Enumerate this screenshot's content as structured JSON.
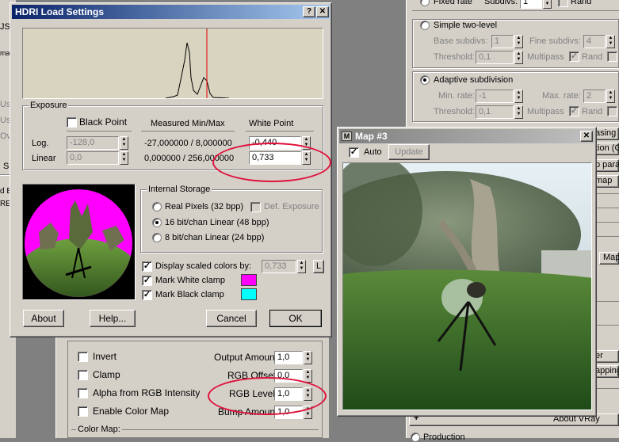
{
  "hdri_dialog": {
    "title": "HDRI Load Settings",
    "help_btn": "?",
    "close_btn": "✕",
    "exposure": {
      "group_label": "Exposure",
      "black_point_label": "Black Point",
      "measured_label": "Measured Min/Max",
      "white_point_label": "White Point",
      "log_label": "Log.",
      "linear_label": "Linear",
      "black_log": "-128,0",
      "black_linear": "0,0",
      "measured_log": "-27,000000 / 8,000000",
      "measured_linear": "0,000000 / 256,000000",
      "white_log": "-0,440",
      "white_linear": "0,733"
    },
    "internal_storage": {
      "group_label": "Internal Storage",
      "options": [
        "Real Pixels (32 bpp)",
        "16 bit/chan Linear (48 bpp)",
        "8 bit/chan Linear (24 bpp)"
      ],
      "selected_index": 1,
      "def_exposure_label": "Def. Exposure"
    },
    "display_scaled_label": "Display scaled colors by:",
    "display_scaled_value": "0,733",
    "l_button": "L",
    "mark_white_label": "Mark White clamp",
    "mark_black_label": "Mark Black clamp",
    "white_clamp_color": "#ff00ff",
    "black_clamp_color": "#00ffff",
    "about_btn": "About",
    "help_button": "Help...",
    "cancel_btn": "Cancel",
    "ok_btn": "OK"
  },
  "map_window": {
    "title": "Map #3",
    "close_btn": "✕",
    "auto_label": "Auto",
    "update_btn": "Update"
  },
  "bg_panel": {
    "invert_label": "Invert",
    "clamp_label": "Clamp",
    "alpha_label": "Alpha from RGB Intensity",
    "enable_color_map_label": "Enable Color Map",
    "output_amount_label": "Output Amount:",
    "output_amount": "1,0",
    "rgb_offset_label": "RGB Offset:",
    "rgb_offset": "0,0",
    "rgb_level_label": "RGB Level:",
    "rgb_level": "1,0",
    "bump_amount_label": "Bump Amount:",
    "bump_amount": "1,0",
    "color_map_label": "Color Map:"
  },
  "right_panel": {
    "fixed_rate_label": "Fixed rate",
    "subdivs_label": "Subdivs:",
    "subdivs_value": "1",
    "rand_label": "Rand",
    "simple_two_level_label": "Simple two-level",
    "base_subdivs_label": "Base subdivs:",
    "base_subdivs": "1",
    "fine_subdivs_label": "Fine subdivs:",
    "fine_subdivs": "4",
    "threshold_label": "Threshold:",
    "threshold1": "0,1",
    "multipass_label": "Multipass",
    "adaptive_label": "Adaptive subdivision",
    "min_rate_label": "Min. rate:",
    "min_rate": "-1",
    "max_rate_label": "Max. rate:",
    "max_rate": "2",
    "threshold2": "0,1",
    "side_tabs": [
      "asing",
      "tion (GI)",
      "p para",
      "map",
      "Map",
      "er",
      "apping"
    ],
    "about_vray": "About VRay",
    "plus": "+",
    "production_label": "Production"
  },
  "left_edge": [
    "JS",
    "mat",
    "Us",
    "Us",
    "Ov",
    "Se",
    "d Bi",
    "RES"
  ]
}
